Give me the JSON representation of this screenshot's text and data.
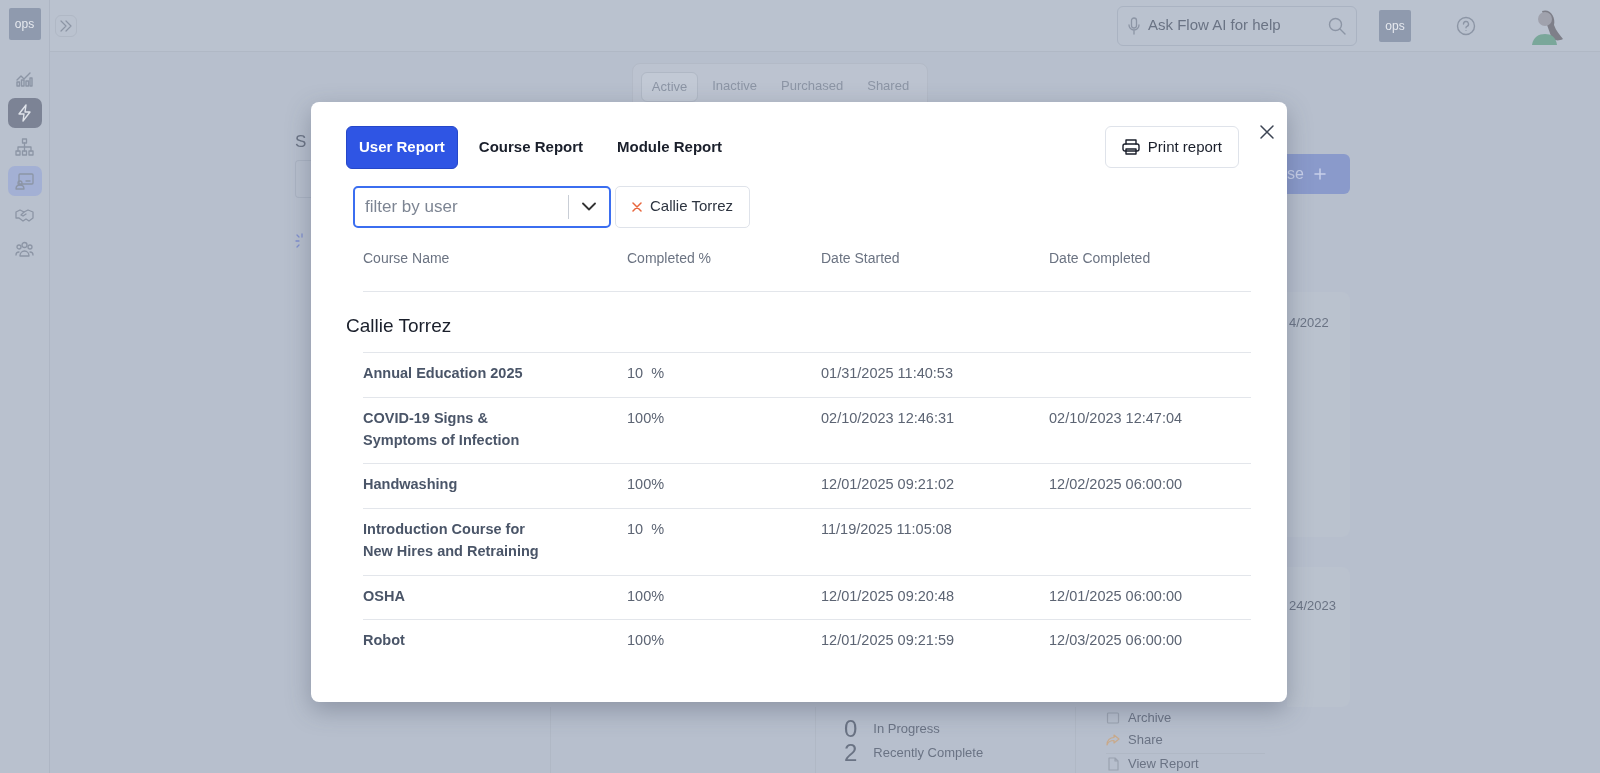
{
  "sidebar": {
    "logo": "ops",
    "items": [
      {
        "kind": "chart",
        "selected": false,
        "highlighted": false
      },
      {
        "kind": "bolt",
        "selected": true,
        "highlighted": false
      },
      {
        "kind": "org",
        "selected": false,
        "highlighted": false
      },
      {
        "kind": "presentation",
        "selected": false,
        "highlighted": true
      },
      {
        "kind": "handshake",
        "selected": false,
        "highlighted": false
      },
      {
        "kind": "people",
        "selected": false,
        "highlighted": false
      }
    ]
  },
  "topbar": {
    "search": {
      "placeholder": "Ask Flow AI for help"
    },
    "logo": "ops"
  },
  "tabs": [
    {
      "label": "Active",
      "selected": true
    },
    {
      "label": "Inactive",
      "selected": false
    },
    {
      "label": "Purchased",
      "selected": false
    },
    {
      "label": "Shared",
      "selected": false
    }
  ],
  "background": {
    "label_fragment": "S",
    "button_fragment": "se",
    "date_fragments": [
      "4/2022",
      "24/2023"
    ],
    "stats": [
      {
        "count": "0",
        "label": "In Progress"
      },
      {
        "count": "2",
        "label": "Recently Complete"
      }
    ],
    "actions": [
      {
        "kind": "archive",
        "label": "Archive"
      },
      {
        "kind": "share",
        "label": "Share"
      },
      {
        "kind": "report",
        "label": "View Report"
      }
    ]
  },
  "modal": {
    "tabs": [
      {
        "label": "User Report",
        "selected": true
      },
      {
        "label": "Course Report",
        "selected": false
      },
      {
        "label": "Module Report",
        "selected": false
      }
    ],
    "print_button": "Print report",
    "filter": {
      "placeholder": "filter by user"
    },
    "chips": [
      "Callie Torrez"
    ],
    "columns": [
      "Course Name",
      "Completed %",
      "Date Started",
      "Date Completed"
    ],
    "groups": [
      {
        "name": "Callie Torrez",
        "rows": [
          {
            "course": "Annual Education 2025",
            "percent": "10  %",
            "started": "01/31/2025 11:40:53"
          },
          {
            "course": "COVID-19 Signs & Symptoms of Infection",
            "percent": "100%",
            "started": "02/10/2023 12:46:31",
            "completed": "02/10/2023 12:47:04"
          },
          {
            "course": "Handwashing",
            "percent": "100%",
            "started": "12/01/2025 09:21:02",
            "completed": "12/02/2025 06:00:00"
          },
          {
            "course": "Introduction Course for New Hires and Retraining",
            "percent": "10  %",
            "started": "11/19/2025 11:05:08"
          },
          {
            "course": "OSHA",
            "percent": "100%",
            "started": "12/01/2025 09:20:48",
            "completed": "12/01/2025 06:00:00"
          },
          {
            "course": "Robot",
            "percent": "100%",
            "started": "12/01/2025 09:21:59",
            "completed": "12/03/2025 06:00:00"
          }
        ]
      }
    ]
  }
}
